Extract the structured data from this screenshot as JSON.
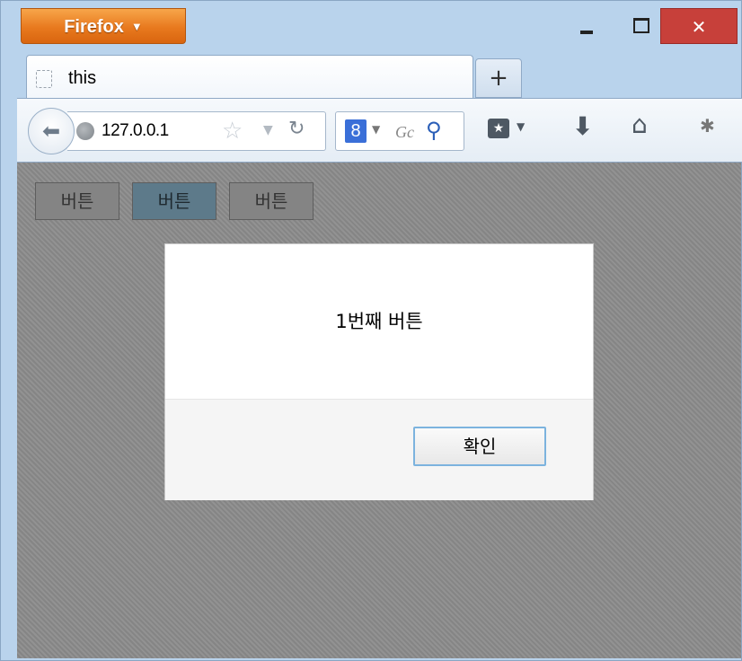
{
  "titlebar": {
    "app_button_label": "Firefox",
    "minimize_glyph": "",
    "maximize_glyph": "",
    "close_glyph": "✕"
  },
  "tabs": [
    {
      "title": "this",
      "favicon": "blank-page-icon",
      "active": true
    }
  ],
  "new_tab_label": "+",
  "navbar": {
    "url": "127.0.0.1",
    "search_placeholder": "Gc",
    "search_engine_letter": "8",
    "icons": [
      "back-icon",
      "globe-icon",
      "star-icon",
      "reload-icon",
      "google-icon",
      "magnifier-icon",
      "bookmarks-icon",
      "download-icon",
      "home-icon",
      "addon-icon"
    ]
  },
  "page": {
    "buttons": [
      {
        "label": "버튼",
        "active": false
      },
      {
        "label": "버튼",
        "active": true
      },
      {
        "label": "버튼",
        "active": false
      }
    ]
  },
  "dialog": {
    "message": "1번째 버튼",
    "ok_label": "확인"
  },
  "colors": {
    "firefox_orange": "#e8791e",
    "close_red": "#c7403a",
    "overlay_gray": "#8c8c8c",
    "active_button": "#5d7a8a",
    "focus_ring": "#7cb3de"
  }
}
